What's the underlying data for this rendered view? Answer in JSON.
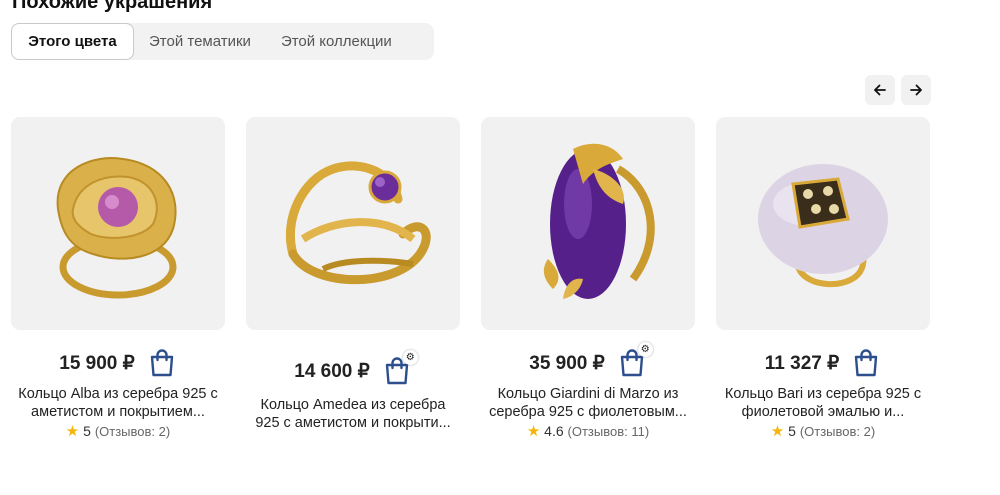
{
  "section_title": "Похожие украшения",
  "tabs": [
    {
      "label": "Этого цвета",
      "active": true
    },
    {
      "label": "Этой тематики",
      "active": false
    },
    {
      "label": "Этой коллекции",
      "active": false
    }
  ],
  "nav": {
    "prev_icon": "arrow-left-icon",
    "next_icon": "arrow-right-icon"
  },
  "products": [
    {
      "price": "15 900 ₽",
      "name_line1": "Кольцо Alba из серебра 925 с",
      "name_line2": "аметистом и покрытием...",
      "rating": "5",
      "reviews": "(Отзывов: 2)",
      "gem_color": "#b45aa8",
      "has_settings_badge": false
    },
    {
      "price": "14 600 ₽",
      "name_line1": "Кольцо Amedea из серебра",
      "name_line2": "925 с аметистом и покрыти...",
      "rating": "",
      "reviews": "",
      "gem_color": "#6b2d9a",
      "has_settings_badge": true
    },
    {
      "price": "35 900 ₽",
      "name_line1": "Кольцо Giardini di Marzo из",
      "name_line2": "серебра 925 с фиолетовым...",
      "rating": "4.6",
      "reviews": "(Отзывов: 11)",
      "gem_color": "#55208a",
      "has_settings_badge": true
    },
    {
      "price": "11 327 ₽",
      "name_line1": "Кольцо Bari из серебра 925 с",
      "name_line2": "фиолетовой эмалью и...",
      "rating": "5",
      "reviews": "(Отзывов: 2)",
      "gem_color": "#dcd4e4",
      "has_settings_badge": false
    }
  ],
  "colors": {
    "accent_blue": "#2d4f8e",
    "gold": "#d9a93a",
    "star": "#f5b50a",
    "card_bg": "#f1f1f1"
  }
}
